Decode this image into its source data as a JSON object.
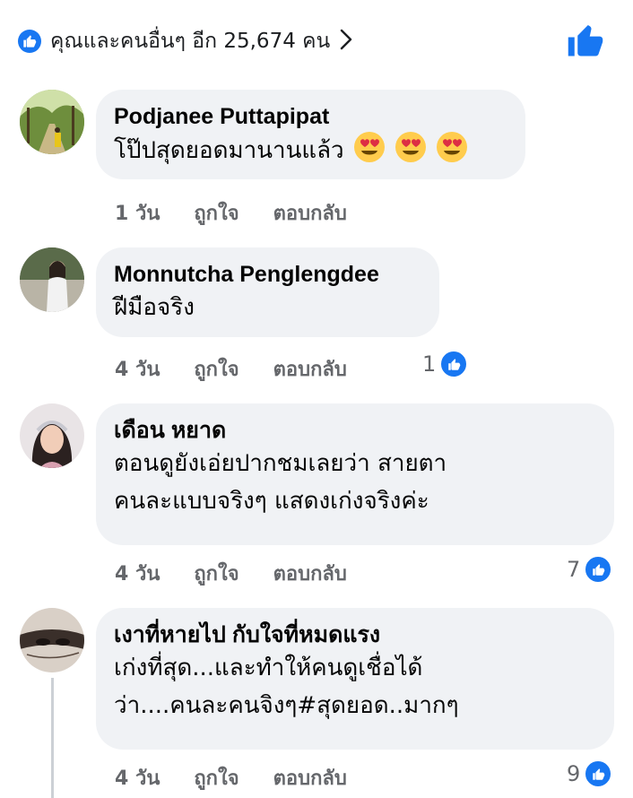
{
  "likes_summary": {
    "text": "คุณและคนอื่นๆ อีก 25,674 คน"
  },
  "comments": [
    {
      "author": "Podjanee Puttapipat",
      "text_lines": [
        "โป๊ปสุดยอดมานานแล้ว"
      ],
      "emoji_count": 3,
      "time": "1 วัน",
      "like_label": "ถูกใจ",
      "reply_label": "ตอบกลับ",
      "reactions": ""
    },
    {
      "author": "Monnutcha Penglengdee",
      "text_lines": [
        "ฝีมือจริง"
      ],
      "time": "4 วัน",
      "like_label": "ถูกใจ",
      "reply_label": "ตอบกลับ",
      "reactions": "1"
    },
    {
      "author": "เดือน หยาด",
      "text_lines": [
        "ตอนดูยังเอ่ยปากชมเลยว่า สายตา",
        "คนละแบบจริงๆ แสดงเก่งจริงค่ะ"
      ],
      "time": "4 วัน",
      "like_label": "ถูกใจ",
      "reply_label": "ตอบกลับ",
      "reactions": "7"
    },
    {
      "author": "เงาที่หายไป กับใจที่หมดแรง",
      "text_lines": [
        "เก่งที่สุด...และทำให้คนดูเชื่อได้",
        "ว่า....คนละคนจิงๆ#สุดยอด..มากๆ"
      ],
      "time": "4 วัน",
      "like_label": "ถูกใจ",
      "reply_label": "ตอบกลับ",
      "reactions": "9"
    }
  ],
  "colors": {
    "accent": "#1877f2",
    "bubble": "#f0f2f5",
    "meta": "#65676b"
  }
}
